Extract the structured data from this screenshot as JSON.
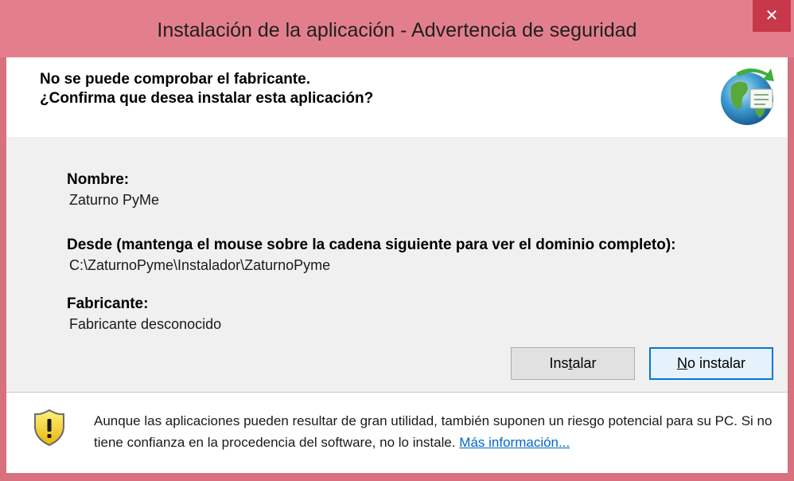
{
  "window": {
    "title": "Instalación de la aplicación - Advertencia de seguridad",
    "close_glyph": "✕"
  },
  "header": {
    "line1": "No se puede comprobar el fabricante.",
    "line2": "¿Confirma que desea instalar esta aplicación?",
    "icon": "globe-install-icon"
  },
  "details": {
    "name_label": "Nombre:",
    "name_value": "Zaturno PyMe",
    "from_label": "Desde (mantenga el mouse sobre la cadena siguiente para ver el dominio completo):",
    "from_value": "C:\\ZaturnoPyme\\Instalador\\ZaturnoPyme",
    "publisher_label": "Fabricante:",
    "publisher_value": "Fabricante desconocido"
  },
  "buttons": {
    "install_pre": "Ins",
    "install_mnemonic": "t",
    "install_post": "alar",
    "noinstall_mnemonic": "N",
    "noinstall_post": "o instalar"
  },
  "footer": {
    "icon": "warning-shield-icon",
    "text": "Aunque las aplicaciones pueden resultar de gran utilidad, también suponen un riesgo potencial para su PC. Si no tiene confianza en la procedencia del software, no lo instale. ",
    "link": "Más información..."
  },
  "colors": {
    "titlebar": "#e37f8d",
    "close_button": "#c7394a",
    "focus_border": "#0078d7",
    "link": "#0066cc"
  }
}
